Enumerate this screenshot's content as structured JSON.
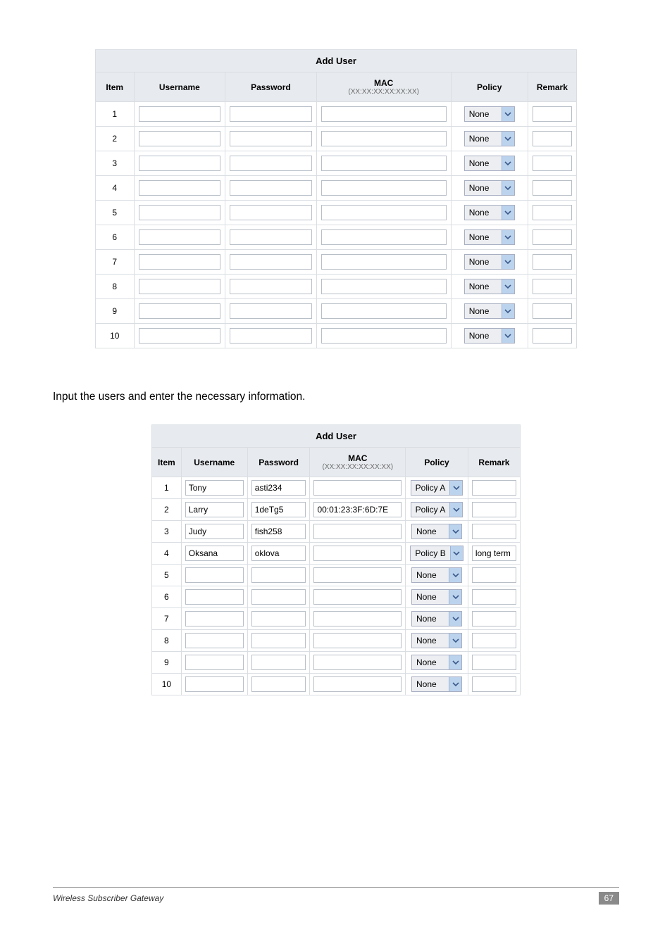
{
  "table_title": "Add User",
  "headers": {
    "item": "Item",
    "username": "Username",
    "password": "Password",
    "mac": "MAC",
    "mac_sub": "(XX:XX:XX:XX:XX:XX)",
    "policy": "Policy",
    "remark": "Remark"
  },
  "instruction": "Input the users and enter the necessary information.",
  "table1_rows": [
    {
      "n": "1",
      "user": "",
      "pass": "",
      "mac": "",
      "policy": "None",
      "remark": ""
    },
    {
      "n": "2",
      "user": "",
      "pass": "",
      "mac": "",
      "policy": "None",
      "remark": ""
    },
    {
      "n": "3",
      "user": "",
      "pass": "",
      "mac": "",
      "policy": "None",
      "remark": ""
    },
    {
      "n": "4",
      "user": "",
      "pass": "",
      "mac": "",
      "policy": "None",
      "remark": ""
    },
    {
      "n": "5",
      "user": "",
      "pass": "",
      "mac": "",
      "policy": "None",
      "remark": ""
    },
    {
      "n": "6",
      "user": "",
      "pass": "",
      "mac": "",
      "policy": "None",
      "remark": ""
    },
    {
      "n": "7",
      "user": "",
      "pass": "",
      "mac": "",
      "policy": "None",
      "remark": ""
    },
    {
      "n": "8",
      "user": "",
      "pass": "",
      "mac": "",
      "policy": "None",
      "remark": ""
    },
    {
      "n": "9",
      "user": "",
      "pass": "",
      "mac": "",
      "policy": "None",
      "remark": ""
    },
    {
      "n": "10",
      "user": "",
      "pass": "",
      "mac": "",
      "policy": "None",
      "remark": ""
    }
  ],
  "table2_rows": [
    {
      "n": "1",
      "user": "Tony",
      "pass": "asti234",
      "mac": "",
      "policy": "Policy A",
      "remark": ""
    },
    {
      "n": "2",
      "user": "Larry",
      "pass": "1deTg5",
      "mac": "00:01:23:3F:6D:7E",
      "policy": "Policy A",
      "remark": ""
    },
    {
      "n": "3",
      "user": "Judy",
      "pass": "fish258",
      "mac": "",
      "policy": "None",
      "remark": ""
    },
    {
      "n": "4",
      "user": "Oksana",
      "pass": "oklova",
      "mac": "",
      "policy": "Policy B",
      "remark": "long term"
    },
    {
      "n": "5",
      "user": "",
      "pass": "",
      "mac": "",
      "policy": "None",
      "remark": ""
    },
    {
      "n": "6",
      "user": "",
      "pass": "",
      "mac": "",
      "policy": "None",
      "remark": ""
    },
    {
      "n": "7",
      "user": "",
      "pass": "",
      "mac": "",
      "policy": "None",
      "remark": ""
    },
    {
      "n": "8",
      "user": "",
      "pass": "",
      "mac": "",
      "policy": "None",
      "remark": ""
    },
    {
      "n": "9",
      "user": "",
      "pass": "",
      "mac": "",
      "policy": "None",
      "remark": ""
    },
    {
      "n": "10",
      "user": "",
      "pass": "",
      "mac": "",
      "policy": "None",
      "remark": ""
    }
  ],
  "footer": {
    "title": "Wireless Subscriber Gateway",
    "page": "67"
  }
}
